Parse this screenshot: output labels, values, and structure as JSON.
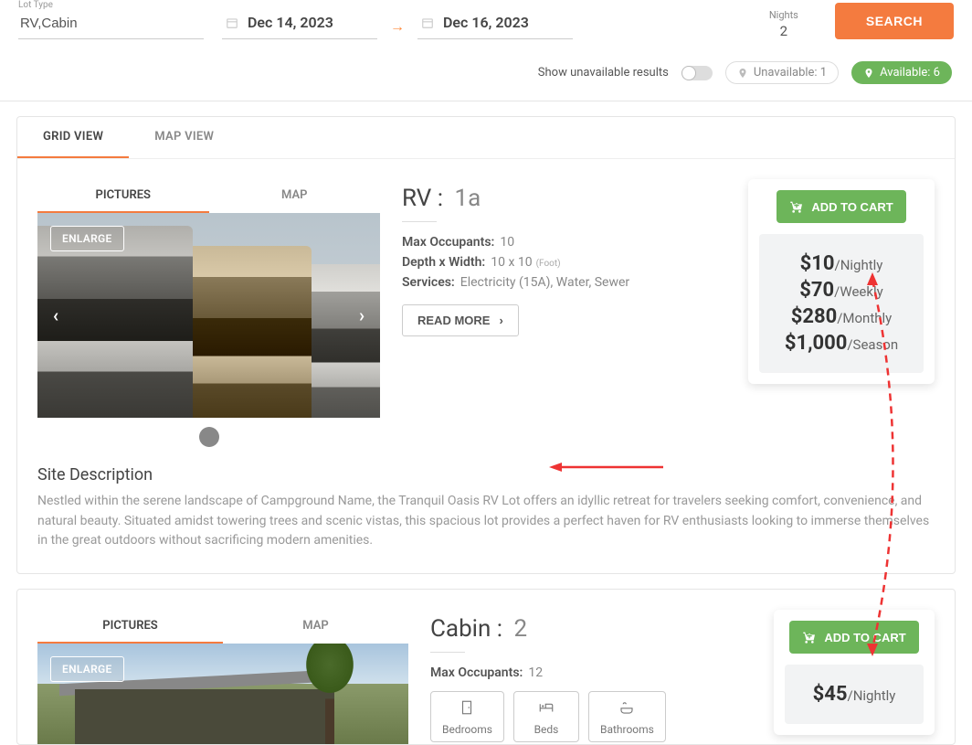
{
  "search": {
    "lot_type_label": "Lot Type",
    "lot_type_value": "RV,Cabin",
    "date_from": "Dec 14, 2023",
    "date_to": "Dec 16, 2023",
    "nights_label": "Nights",
    "nights_value": "2",
    "button": "SEARCH"
  },
  "filters": {
    "toggle_label": "Show unavailable results",
    "unavailable_label": "Unavailable: 1",
    "available_label": "Available: 6"
  },
  "view_tabs": {
    "grid": "GRID VIEW",
    "map": "MAP VIEW"
  },
  "sub_tabs": {
    "pictures": "PICTURES",
    "map": "MAP"
  },
  "enlarge": "ENLARGE",
  "listing1": {
    "type": "RV :",
    "unit": "1a",
    "specs": {
      "occ_label": "Max Occupants:",
      "occ_val": "10",
      "dim_label": "Depth x Width:",
      "dim_val": "10 x 10",
      "dim_unit": "(Foot)",
      "srv_label": "Services:",
      "srv_val": "Electricity (15A), Water, Sewer"
    },
    "read_more": "READ MORE",
    "add_cart": "ADD TO CART",
    "prices": [
      {
        "amt": "$10",
        "per": "/Nightly"
      },
      {
        "amt": "$70",
        "per": "/Weekly"
      },
      {
        "amt": "$280",
        "per": "/Monthly"
      },
      {
        "amt": "$1,000",
        "per": "/Season"
      }
    ],
    "desc_title": "Site Description",
    "desc_text": "Nestled within the serene landscape of Campground Name, the Tranquil Oasis RV Lot offers an idyllic retreat for travelers seeking comfort, convenience, and natural beauty. Situated amidst towering trees and scenic vistas, this spacious lot provides a perfect haven for RV enthusiasts looking to immerse themselves in the great outdoors without sacrificing modern amenities."
  },
  "listing2": {
    "type": "Cabin :",
    "unit": "2",
    "specs": {
      "occ_label": "Max Occupants:",
      "occ_val": "12"
    },
    "add_cart": "ADD TO CART",
    "prices": [
      {
        "amt": "$45",
        "per": "/Nightly"
      }
    ],
    "attrs": {
      "bedrooms": "Bedrooms",
      "beds": "Beds",
      "bathrooms": "Bathrooms"
    }
  }
}
